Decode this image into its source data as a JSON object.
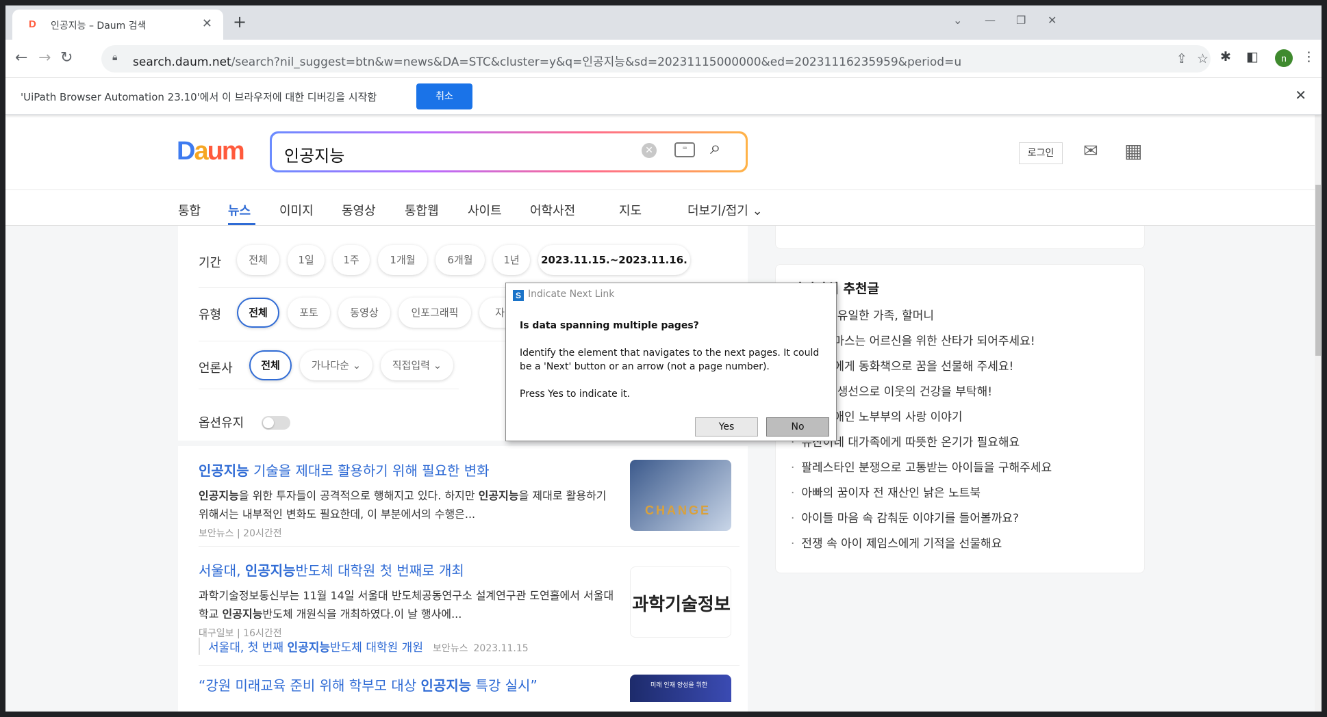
{
  "browser": {
    "tab_title": "인공지능 – Daum 검색",
    "tab_close": "✕",
    "new_tab": "+",
    "url_host": "search.daum.net",
    "url_rest": "/search?nil_suggest=btn&w=news&DA=STC&cluster=y&q=인공지능&sd=20231115000000&ed=20231116235959&period=u",
    "profile_initial": "n"
  },
  "infobar": {
    "message": "'UiPath Browser Automation 23.10'에서 이 브라우저에 대한 디버깅을 시작함",
    "cancel_label": "취소",
    "close": "✕"
  },
  "header": {
    "search_query": "인공지능",
    "login_label": "로그인"
  },
  "tabs": {
    "items": [
      "통합",
      "뉴스",
      "이미지",
      "동영상",
      "통합웹",
      "사이트",
      "어학사전",
      "지도",
      "더보기/접기 ⌄"
    ],
    "active": "뉴스"
  },
  "filters": {
    "period_label": "기간",
    "period_options": [
      "전체",
      "1일",
      "1주",
      "1개월",
      "6개월",
      "1년"
    ],
    "period_range": "2023.11.15.~2023.11.16. ⌄",
    "type_label": "유형",
    "type_options": [
      "전체",
      "포토",
      "동영상",
      "인포그래픽",
      "자"
    ],
    "press_label": "언론사",
    "press_options": [
      "전체",
      "가나다순 ⌄",
      "직접입력 ⌄"
    ],
    "keep_label": "옵션유지"
  },
  "results": [
    {
      "title_kw": "인공지능",
      "title_rest": " 기술을 제대로 활용하기 위해 필요한 변화",
      "snippet_kw1": "인공지능",
      "snippet_a": "을 위한 투자들이 공격적으로 행해지고 있다. 하지만 ",
      "snippet_kw2": "인공지능",
      "snippet_b": "을 제대로 활용하기 위해서는 내부적인 변화도 필요한데, 이 부분에서의 수행은...",
      "source": "보안뉴스",
      "time": "20시간전",
      "thumb_text": "CHANGE"
    },
    {
      "title_a": "서울대, ",
      "title_kw": "인공지능",
      "title_rest": "반도체 대학원 첫 번째로 개최",
      "snippet_a": "과학기술정보통신부는 11월 14일 서울대 반도체공동연구소 설계연구관 도연홀에서 서울대학교 ",
      "snippet_kw": "인공지능",
      "snippet_b": "반도체 개원식을 개최하였다.이 날 행사에...",
      "source": "대구일보",
      "time": "16시간전",
      "thumb_text": "과학기술정보",
      "related_a": "서울대, 첫 번째 ",
      "related_kw": "인공지능",
      "related_b": "반도체 대학원 개원",
      "related_source": "보안뉴스",
      "related_date": "2023.11.15"
    },
    {
      "title_a": "“강원 미래교육 준비 위해 학부모 대상 ",
      "title_kw": "인공지능",
      "title_rest": " 특강 실시”",
      "thumb_text": "미래 인재 양성을 위한"
    }
  ],
  "sidebar": {
    "title": "같이가치 추천글",
    "items": [
      "민우의 유일한 가족, 할머니",
      "크리스마스는 어르신을 위한 산타가 되어주세요!",
      "아이들에게 동화책으로 꿈을 선물해 주세요!",
      "따뜻한 생선으로 이웃의 건강을 부탁해!",
      "시각장애인 노부부의 사랑 이야기",
      "유산이네 대가족에게 따뜻한 온기가 필요해요",
      "팔레스타인 분쟁으로 고통받는 아이들을 구해주세요",
      "아빠의 꿈이자 전 재산인 낡은 노트북",
      "아이들 마음 속 감춰둔 이야기를 들어볼까요?",
      "전쟁 속 아이 제임스에게 기적을 선물해요"
    ]
  },
  "dialog": {
    "title": "Indicate Next Link",
    "question": "Is data spanning multiple pages?",
    "description": "Identify the element that navigates to the next pages. It could be a 'Next' button or an arrow (not a page number).",
    "prompt": "Press Yes to indicate it.",
    "yes_label": "Yes",
    "no_label": "No"
  },
  "colors": {
    "accent": "#2f6bd5",
    "debug_button": "#1a73e8"
  }
}
